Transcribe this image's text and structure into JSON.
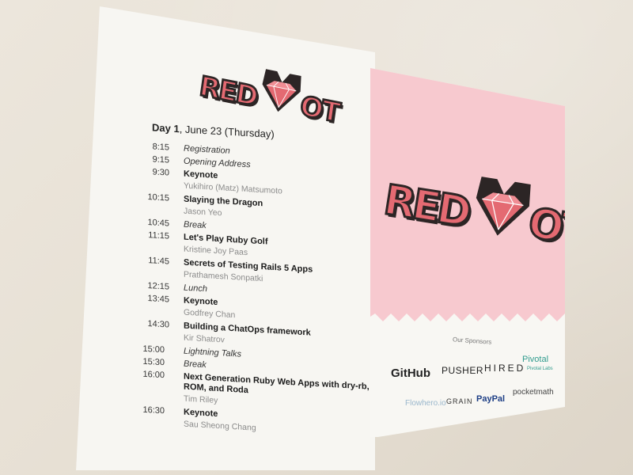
{
  "logo": {
    "letters": [
      "R",
      "E",
      "D",
      "O",
      "T"
    ]
  },
  "schedule": {
    "day_label": "Day 1",
    "day_date": ", June 23 (Thursday)",
    "items": [
      {
        "time": "8:15",
        "title": "Registration",
        "style": "italic",
        "speaker": ""
      },
      {
        "time": "9:15",
        "title": "Opening Address",
        "style": "italic",
        "speaker": ""
      },
      {
        "time": "9:30",
        "title": "Keynote",
        "style": "bold",
        "speaker": "Yukihiro (Matz) Matsumoto"
      },
      {
        "time": "10:15",
        "title": "Slaying the Dragon",
        "style": "bold",
        "speaker": "Jason Yeo"
      },
      {
        "time": "10:45",
        "title": "Break",
        "style": "italic",
        "speaker": ""
      },
      {
        "time": "11:15",
        "title": "Let's Play Ruby Golf",
        "style": "bold",
        "speaker": "Kristine Joy Paas"
      },
      {
        "time": "11:45",
        "title": "Secrets of Testing Rails 5 Apps",
        "style": "bold",
        "speaker": "Prathamesh Sonpatki"
      },
      {
        "time": "12:15",
        "title": "Lunch",
        "style": "italic",
        "speaker": ""
      },
      {
        "time": "13:45",
        "title": "Keynote",
        "style": "bold",
        "speaker": "Godfrey Chan"
      },
      {
        "time": "14:30",
        "title": "Building a ChatOps framework",
        "style": "bold",
        "speaker": "Kir Shatrov"
      },
      {
        "time": "15:00",
        "title": "Lightning Talks",
        "style": "italic",
        "speaker": ""
      },
      {
        "time": "15:30",
        "title": "Break",
        "style": "italic",
        "speaker": ""
      },
      {
        "time": "16:00",
        "title": "Next Generation Ruby Web Apps with dry-rb,",
        "title2": "ROM, and Roda",
        "style": "bold",
        "speaker": "Tim Riley"
      },
      {
        "time": "16:30",
        "title": "Keynote",
        "style": "bold",
        "speaker": "Sau Sheong Chang"
      }
    ]
  },
  "sponsors": {
    "label": "Our Sponsors",
    "github": "GitHub",
    "pusher": "PUSHER",
    "hired": "HIRED",
    "pivotal": "Pivotal",
    "pivotal_sub": "Pivotal Labs",
    "flowhero": "Flowhero.io",
    "grain": "GRAIN",
    "paypal": "PayPal",
    "pocketmath": "pocketmath"
  },
  "colors": {
    "brand_red": "#e46a72",
    "outline": "#2c2525",
    "pink_bg": "#f7c9cf"
  }
}
